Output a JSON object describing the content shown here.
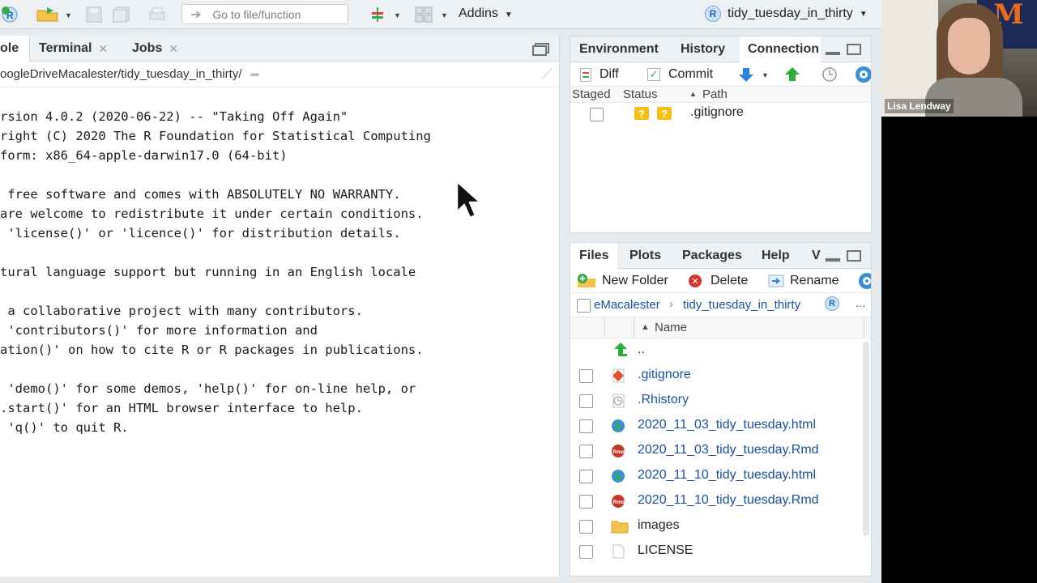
{
  "toolbar": {
    "goto_placeholder": "Go to file/function",
    "addins_label": "Addins",
    "project_name": "tidy_tuesday_in_thirty"
  },
  "console": {
    "tabs": [
      "ole",
      "Terminal",
      "Jobs"
    ],
    "path": "oogleDriveMacalester/tidy_tuesday_in_thirty/",
    "lines": [
      "rsion 4.0.2 (2020-06-22) -- \"Taking Off Again\"",
      "right (C) 2020 The R Foundation for Statistical Computing",
      "form: x86_64-apple-darwin17.0 (64-bit)",
      "",
      " free software and comes with ABSOLUTELY NO WARRANTY.",
      "are welcome to redistribute it under certain conditions.",
      " 'license()' or 'licence()' for distribution details.",
      "",
      "tural language support but running in an English locale",
      "",
      " a collaborative project with many contributors.",
      " 'contributors()' for more information and",
      "ation()' on how to cite R or R packages in publications.",
      "",
      " 'demo()' for some demos, 'help()' for on-line help, or",
      ".start()' for an HTML browser interface to help.",
      " 'q()' to quit R."
    ]
  },
  "git_pane": {
    "tabs": [
      "Environment",
      "History",
      "Connection"
    ],
    "actions": {
      "diff": "Diff",
      "commit": "Commit"
    },
    "columns": {
      "staged": "Staged",
      "status": "Status",
      "path": "Path"
    },
    "rows": [
      {
        "status": "?",
        "path": ".gitignore"
      }
    ]
  },
  "files_pane": {
    "tabs": [
      "Files",
      "Plots",
      "Packages",
      "Help",
      "V"
    ],
    "actions": {
      "new_folder": "New Folder",
      "delete": "Delete",
      "rename": "Rename",
      "more": "..."
    },
    "breadcrumb": {
      "parent": "eMacalester",
      "current": "tidy_tuesday_in_thirty"
    },
    "column_name": "Name",
    "up_label": "..",
    "files": [
      {
        "name": ".gitignore",
        "icon": "git-file-icon"
      },
      {
        "name": ".Rhistory",
        "icon": "history-file-icon"
      },
      {
        "name": "2020_11_03_tidy_tuesday.html",
        "icon": "html-file-icon"
      },
      {
        "name": "2020_11_03_tidy_tuesday.Rmd",
        "icon": "rmd-file-icon"
      },
      {
        "name": "2020_11_10_tidy_tuesday.html",
        "icon": "html-file-icon"
      },
      {
        "name": "2020_11_10_tidy_tuesday.Rmd",
        "icon": "rmd-file-icon"
      },
      {
        "name": "images",
        "icon": "folder-icon"
      },
      {
        "name": "LICENSE",
        "icon": "text-file-icon"
      }
    ]
  },
  "webcam": {
    "name": "Lisa Lendway"
  }
}
